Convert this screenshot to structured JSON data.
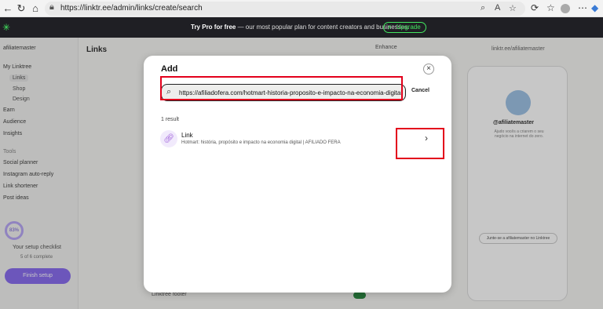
{
  "browser": {
    "url": "https://linktr.ee/admin/links/create/search"
  },
  "banner": {
    "bold": "Try Pro for free",
    "text": " — our most popular plan for content creators and businesses.",
    "upgrade_label": "Upgrade"
  },
  "sidebar": {
    "account": "afiliatemaster",
    "my_linktree": "My Linktree",
    "links": "Links",
    "shop": "Shop",
    "design": "Design",
    "earn": "Earn",
    "audience": "Audience",
    "insights": "Insights",
    "tools": "Tools",
    "social_planner": "Social planner",
    "instagram_auto_reply": "Instagram auto-reply",
    "link_shortener": "Link shortener",
    "post_ideas": "Post ideas",
    "progress": "83%",
    "setup_title": "Your setup checklist",
    "setup_sub": "5 of 6 complete",
    "finish_label": "Finish setup"
  },
  "main": {
    "title": "Links",
    "enhance": "Enhance",
    "linktree_url": "linktr.ee/afiliatemaster",
    "footer_label": "Linktree footer"
  },
  "preview": {
    "name": "@afiliatemaster",
    "bio": "Ajudo vocês a criarem o seu negócio na internet do zero.",
    "join": "Junte-se a afiliatemaster no Linktree"
  },
  "modal": {
    "title": "Add",
    "search_value": "https://afiliadofera.com/hotmart-historia-proposito-e-impacto-na-economia-digital",
    "cancel_label": "Cancel",
    "result_count": "1 result",
    "result": {
      "title": "Link",
      "description": "Hotmart: história, propósito e impacto na economia digital | AFILIADO FERA"
    }
  },
  "colors": {
    "highlight": "#e3001b",
    "brand_green": "#43e660",
    "accent_purple": "#8b6ff0"
  }
}
